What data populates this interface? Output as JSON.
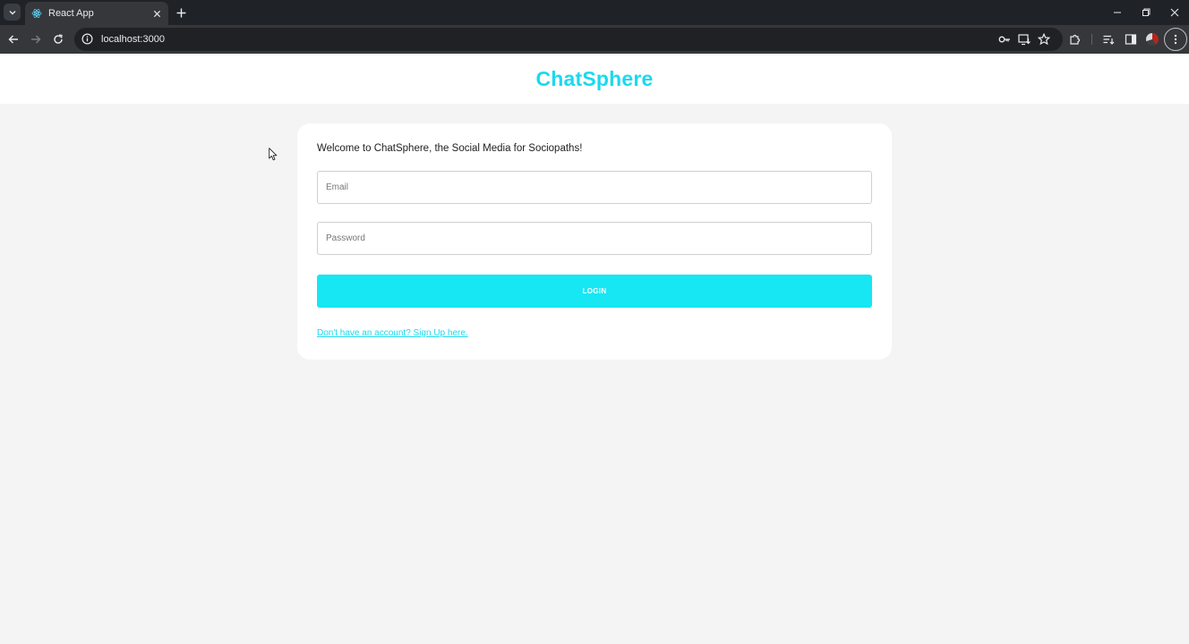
{
  "browser": {
    "tab_title": "React App",
    "url": "localhost:3000",
    "icons": {
      "tab_search": "chevron-down-icon",
      "favicon": "react-icon",
      "tab_close": "close-icon",
      "new_tab": "plus-icon",
      "back": "arrow-left-icon",
      "forward": "arrow-right-icon",
      "reload": "reload-icon",
      "site_info": "info-icon",
      "password": "key-icon",
      "install": "install-app-icon",
      "bookmark": "star-icon",
      "extensions": "puzzle-icon",
      "reading_list": "reading-list-icon",
      "side_panel": "side-panel-icon",
      "menu": "more-vert-icon"
    }
  },
  "app": {
    "brand": "ChatSphere",
    "welcome": "Welcome to ChatSphere, the Social Media for Sociopaths!",
    "email_placeholder": "Email",
    "password_placeholder": "Password",
    "login_label": "LOGIN",
    "signup_link": "Don't have an account? Sign Up here."
  },
  "colors": {
    "accent": "#17e6f3",
    "brand": "#1bd9ee",
    "page_background": "#f4f4f4",
    "chrome_dark": "#1f2226",
    "chrome_toolbar": "#35373b"
  }
}
